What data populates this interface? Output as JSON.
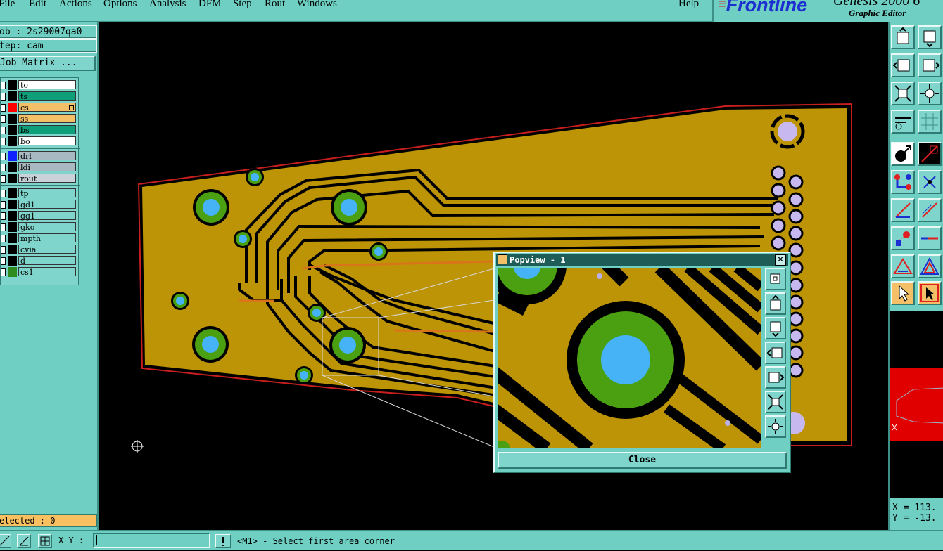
{
  "menu": [
    "File",
    "Edit",
    "Actions",
    "Options",
    "Analysis",
    "DFM",
    "Step",
    "Rout",
    "Windows"
  ],
  "help": "Help",
  "brand": {
    "logo": "Frontline",
    "title": "Genesis 2000  6",
    "subtitle": "Graphic Editor"
  },
  "job": {
    "job_line": "ob : 2s29007qa0",
    "step_line": "tep: cam",
    "matrix_button": "Job Matrix ..."
  },
  "layers": [
    {
      "name": "to",
      "bg": "#ffffff",
      "swatch": "#000000"
    },
    {
      "name": "ts",
      "bg": "#0e9e7a",
      "swatch": "#000000"
    },
    {
      "name": "cs",
      "bg": "#f3c068",
      "swatch": "#ff0000",
      "active": true
    },
    {
      "name": "ss",
      "bg": "#f3c068",
      "swatch": "#000000"
    },
    {
      "name": "bs",
      "bg": "#0e9e7a",
      "swatch": "#000000"
    },
    {
      "name": "bo",
      "bg": "#ffffff",
      "swatch": "#000000"
    },
    {
      "name": "drl",
      "bg": "#a9b9c2",
      "swatch": "#1020ff"
    },
    {
      "name": "ldi",
      "bg": "#a9b9c2",
      "swatch": "#000000"
    },
    {
      "name": "rout",
      "bg": "#c8d2d8",
      "swatch": "#000000"
    },
    {
      "name": "tp",
      "bg": "#7fd5cb",
      "swatch": "#000000"
    },
    {
      "name": "gd1",
      "bg": "#7fd5cb",
      "swatch": "#000000"
    },
    {
      "name": "gg1",
      "bg": "#7fd5cb",
      "swatch": "#000000"
    },
    {
      "name": "gko",
      "bg": "#7fd5cb",
      "swatch": "#000000"
    },
    {
      "name": "mpth",
      "bg": "#7fd5cb",
      "swatch": "#000000"
    },
    {
      "name": "cvia",
      "bg": "#7fd5cb",
      "swatch": "#000000"
    },
    {
      "name": "d",
      "bg": "#7fd5cb",
      "swatch": "#000000"
    },
    {
      "name": "cs1",
      "bg": "#7fd5cb",
      "swatch": "#2e8b1e"
    }
  ],
  "selected": "elected : 0",
  "coords": {
    "x": "X = 113.",
    "y": "Y = -13."
  },
  "status": {
    "xy_label": "X Y :",
    "xy_value": "",
    "message": "<M1> - Select first area corner"
  },
  "popview": {
    "title": "Popview - 1",
    "close_label": "Close"
  },
  "colors": {
    "panel": "#6fcfc3",
    "board": "#bd9406",
    "trace": "#000000",
    "pad_ring": "#4aa010",
    "pad_hole": "#45b3f5",
    "outline": "#c81e1e"
  }
}
